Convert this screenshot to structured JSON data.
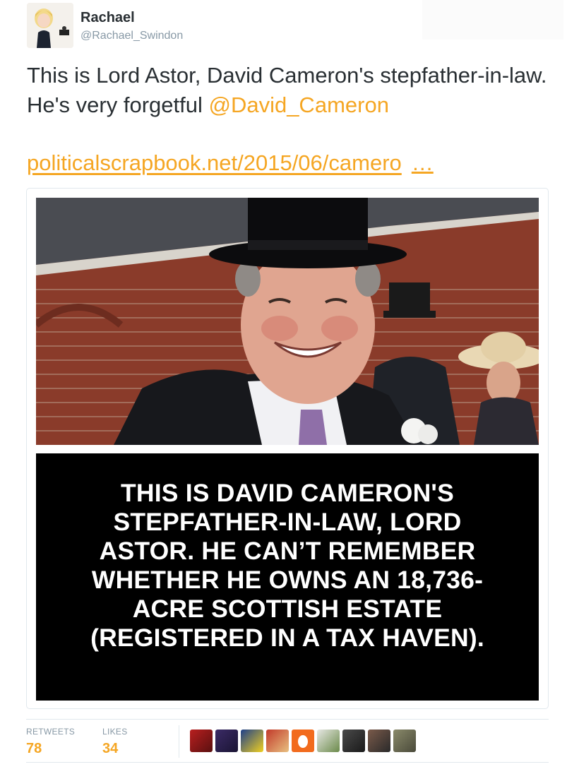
{
  "user": {
    "name": "Rachael",
    "handle": "@Rachael_Swindon"
  },
  "tweet": {
    "text_part1": "This is Lord Astor, David Cameron's stepfather-in-law. He's very forgetful ",
    "mention": "@David_Cameron",
    "link": "politicalscrapbook.net/2015/06/camero",
    "link_ellipsis": "…"
  },
  "media": {
    "caption_lines": [
      "THIS IS DAVID CAMERON'S",
      "STEPFATHER-IN-LAW, LORD",
      "ASTOR. HE CAN’T REMEMBER",
      "WHETHER HE OWNS AN 18,736-",
      "ACRE SCOTTISH ESTATE",
      "(REGISTERED IN A TAX HAVEN)."
    ]
  },
  "stats": {
    "retweets_label": "RETWEETS",
    "retweets_value": "78",
    "likes_label": "LIKES",
    "likes_value": "34"
  },
  "colors": {
    "accent": "#f5a623",
    "text": "#292f33",
    "muted": "#8899a6",
    "border": "#e1e8ed"
  },
  "liker_avatars": [
    "avatar-1",
    "avatar-2",
    "avatar-3",
    "avatar-4",
    "avatar-5",
    "avatar-6",
    "avatar-7",
    "avatar-8",
    "avatar-9"
  ]
}
